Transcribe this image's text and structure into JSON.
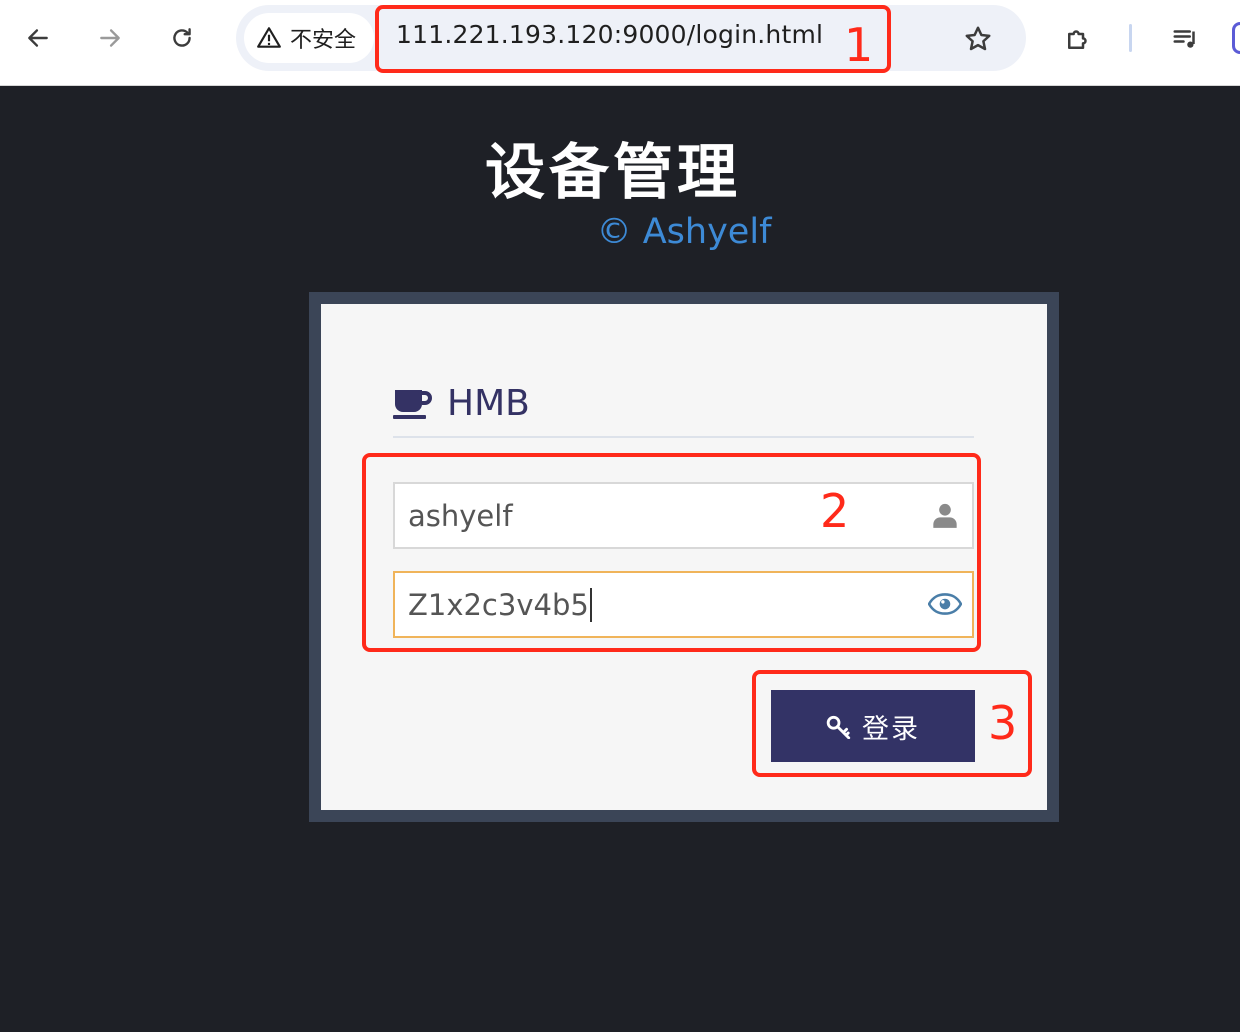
{
  "browser": {
    "security_label": "不安全",
    "url": "111.221.193.120:9000/login.html",
    "icons": [
      "back-arrow-icon",
      "forward-arrow-icon",
      "reload-icon",
      "warning-icon",
      "star-icon",
      "extensions-puzzle-icon",
      "media-controls-icon"
    ]
  },
  "page": {
    "title": "设备管理",
    "copyright": "© Ashyelf"
  },
  "login_card": {
    "brand_icon": "coffee-cup-icon",
    "brand_name": "HMB",
    "username": {
      "value": "ashyelf",
      "icon": "user-icon"
    },
    "password": {
      "value": "Z1x2c3v4b5",
      "icon": "eye-icon"
    },
    "submit": {
      "label": "登录",
      "icon": "key-icon"
    }
  },
  "annotations": {
    "color": "#ff2a1a",
    "labels": [
      "1",
      "2",
      "3"
    ]
  },
  "colors": {
    "page_bg": "#1e2026",
    "card_frame": "#3b4557",
    "card_bg": "#f6f6f6",
    "accent": "#333366",
    "link_blue": "#3d8ad6",
    "focus_border": "#f0b45a"
  }
}
